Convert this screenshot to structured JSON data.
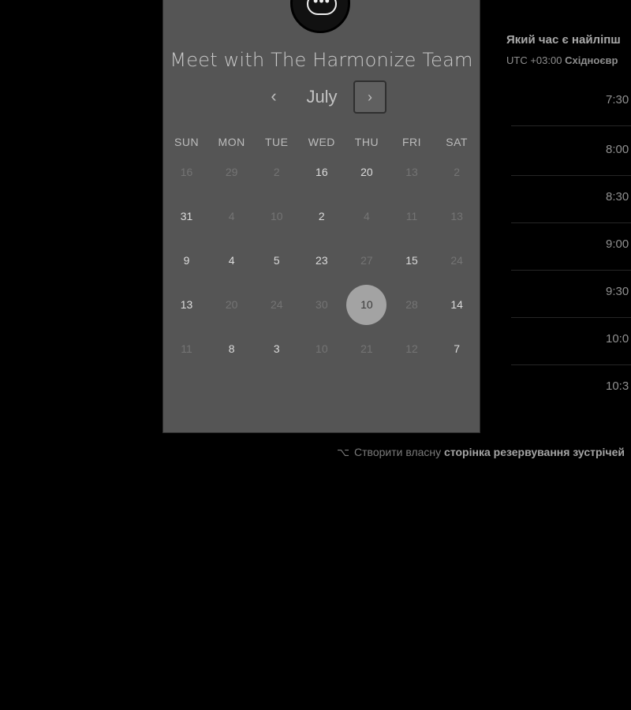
{
  "booking": {
    "title": "Meet with The Harmonize Team",
    "month": "July",
    "prev_icon": "‹",
    "next_icon": "›",
    "weekdays": [
      "SUN",
      "MON",
      "TUE",
      "WED",
      "THU",
      "FRI",
      "SAT"
    ],
    "weeks": [
      [
        {
          "d": "16",
          "s": "muted"
        },
        {
          "d": "29",
          "s": "muted"
        },
        {
          "d": "2",
          "s": "muted"
        },
        {
          "d": "16",
          "s": "active"
        },
        {
          "d": "20",
          "s": "active"
        },
        {
          "d": "13",
          "s": "muted"
        },
        {
          "d": "2",
          "s": "muted"
        }
      ],
      [
        {
          "d": "31",
          "s": "active"
        },
        {
          "d": "4",
          "s": "muted"
        },
        {
          "d": "10",
          "s": "muted"
        },
        {
          "d": "2",
          "s": "active"
        },
        {
          "d": "4",
          "s": "muted"
        },
        {
          "d": "11",
          "s": "muted"
        },
        {
          "d": "13",
          "s": "muted"
        }
      ],
      [
        {
          "d": "9",
          "s": "active"
        },
        {
          "d": "4",
          "s": "active"
        },
        {
          "d": "5",
          "s": "active"
        },
        {
          "d": "23",
          "s": "active"
        },
        {
          "d": "27",
          "s": "muted"
        },
        {
          "d": "15",
          "s": "active"
        },
        {
          "d": "24",
          "s": "muted"
        }
      ],
      [
        {
          "d": "13",
          "s": "active"
        },
        {
          "d": "20",
          "s": "muted"
        },
        {
          "d": "24",
          "s": "muted"
        },
        {
          "d": "30",
          "s": "muted"
        },
        {
          "d": "10",
          "s": "selected"
        },
        {
          "d": "28",
          "s": "muted"
        },
        {
          "d": "14",
          "s": "active"
        }
      ],
      [
        {
          "d": "11",
          "s": "muted"
        },
        {
          "d": "8",
          "s": "active"
        },
        {
          "d": "3",
          "s": "active"
        },
        {
          "d": "10",
          "s": "muted"
        },
        {
          "d": "21",
          "s": "muted"
        },
        {
          "d": "12",
          "s": "muted"
        },
        {
          "d": "7",
          "s": "active"
        }
      ]
    ]
  },
  "side": {
    "title": "Який час є найліпш",
    "tz_prefix": "UTC +03:00",
    "tz_name": "Східноєвр",
    "slots": [
      "7:30",
      "8:00",
      "8:30",
      "9:00",
      "9:30",
      "10:0",
      "10:3"
    ]
  },
  "footer": {
    "icon": "hubspot-icon",
    "text": "Створити власну",
    "link": "сторінка резервування зустрічей"
  },
  "colors": {
    "background": "#000000",
    "card": "#555555",
    "selected_day": "#a3a3a3"
  }
}
